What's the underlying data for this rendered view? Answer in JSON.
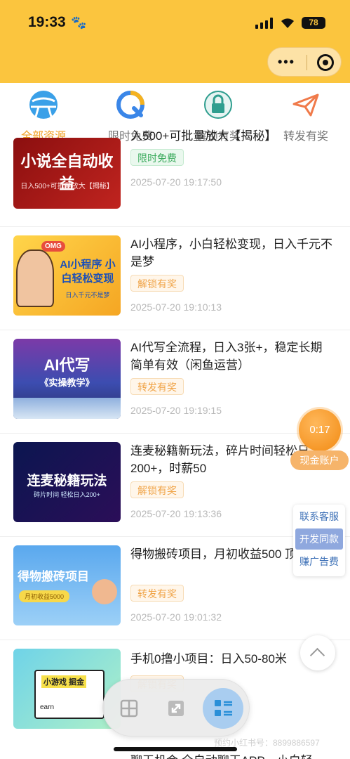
{
  "status_bar": {
    "time": "19:33",
    "battery": "78"
  },
  "header": {
    "capsule_more": "•••"
  },
  "tabs": [
    {
      "label": "全部资源",
      "icon": "globe-icon",
      "active": true
    },
    {
      "label": "限时免费",
      "icon": "q-circle-icon"
    },
    {
      "label": "解锁有奖",
      "icon": "lock-icon"
    },
    {
      "label": "转发有奖",
      "icon": "paper-plane-icon"
    }
  ],
  "items": [
    {
      "title": "入500+可批量放大【揭秘】",
      "badge": "限时免费",
      "date": "2025-07-20 19:17:50",
      "thumb_text": "小说全自动收益",
      "thumb_sub": "日入500+可批量放大【揭秘】"
    },
    {
      "title": "AI小程序，小白轻松变现，日入千元不是梦",
      "badge": "解锁有奖",
      "date": "2025-07-20 19:10:13",
      "thumb_text": "AI小程序 小白轻松变现",
      "thumb_sub": "日入千元不是梦",
      "thumb_omg": "OMG"
    },
    {
      "title": "AI代写全流程，日入3张+，稳定长期简单有效（闲鱼运营）",
      "badge": "转发有奖",
      "date": "2025-07-20 19:19:15",
      "thumb_text": "AI代写",
      "thumb_sub": "《实操教学》"
    },
    {
      "title": "连麦秘籍新玩法，碎片时间轻松日入200+，时薪50",
      "badge": "解锁有奖",
      "date": "2025-07-20 19:13:36",
      "thumb_text": "连麦秘籍玩法",
      "thumb_sub": "碎片时间 轻松日入200+"
    },
    {
      "title": "得物搬砖项目，月初收益500 顶层思维",
      "badge": "转发有奖",
      "date": "2025-07-20 19:01:32",
      "thumb_text": "得物搬砖项目",
      "thumb_sub": "月初收益5000"
    },
    {
      "title": "手机0撸小项目：日入50-80米",
      "badge": "解锁有奖",
      "date": "",
      "thumb_text": "小游戏 掘金",
      "thumb_sub": "earn"
    }
  ],
  "float": {
    "timer": "0:17",
    "cash_account": "现金账户"
  },
  "side_panel": [
    "联系客服",
    "开发同款",
    "赚广告费"
  ],
  "bottom_nav": {
    "icons": [
      "grid-icon",
      "expand-icon",
      "list-icon"
    ]
  },
  "footer": {
    "watermark": "预约小红书号：8899886597",
    "peek_title": "聊天机会  全自动聊天APP，小白轻"
  },
  "colors": {
    "header_bg": "#fbc53e",
    "accent": "#f0a021",
    "green": "#3aaa5c",
    "orange": "#f0a448"
  }
}
